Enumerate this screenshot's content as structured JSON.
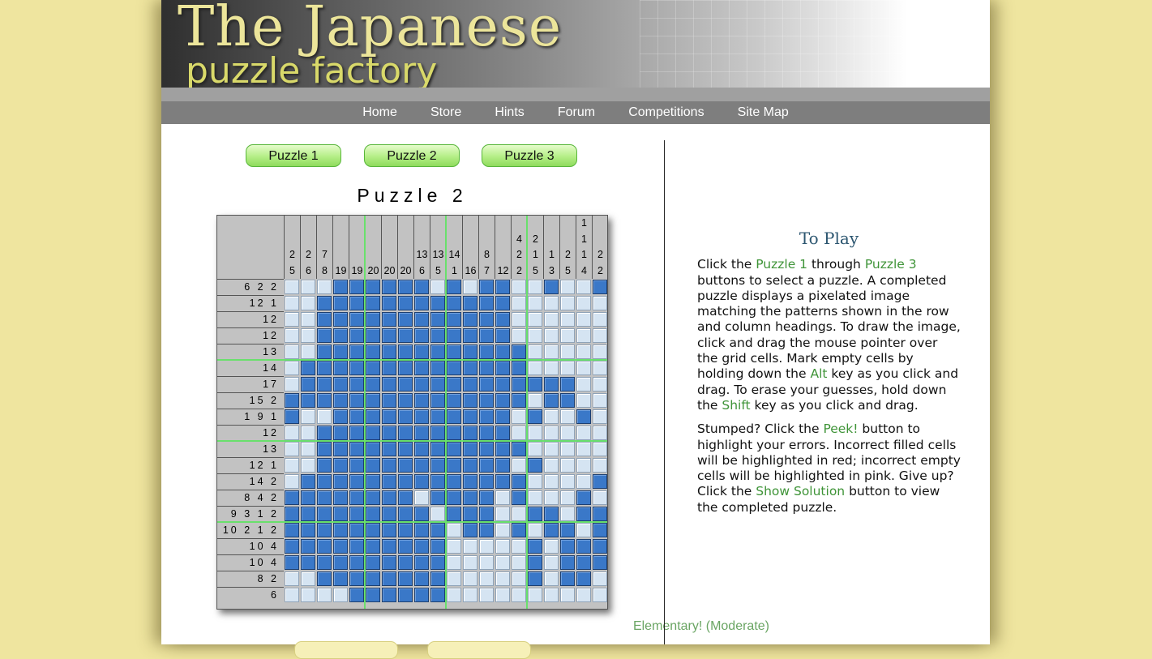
{
  "banner": {
    "title_line1": "The Japanese",
    "title_line2": "puzzle factory"
  },
  "nav": [
    "Home",
    "Store",
    "Hints",
    "Forum",
    "Competitions",
    "Site Map"
  ],
  "puzzle_buttons": [
    "Puzzle 1",
    "Puzzle 2",
    "Puzzle 3"
  ],
  "puzzle_title": "Puzzle 2",
  "column_clues": [
    [
      "2",
      "5"
    ],
    [
      "2",
      "6"
    ],
    [
      "7",
      "8"
    ],
    [
      "19"
    ],
    [
      "19"
    ],
    [
      "20"
    ],
    [
      "20"
    ],
    [
      "20"
    ],
    [
      "13",
      "6"
    ],
    [
      "13",
      "5"
    ],
    [
      "14",
      "1"
    ],
    [
      "16"
    ],
    [
      "8",
      "7"
    ],
    [
      "12"
    ],
    [
      "4",
      "2",
      "2"
    ],
    [
      "2",
      "1",
      "5"
    ],
    [
      "1",
      "3"
    ],
    [
      "2",
      "5"
    ],
    [
      "1",
      "1",
      "1",
      "4"
    ],
    [
      "2",
      "2"
    ]
  ],
  "row_clues": [
    "6 2 2",
    "12 1",
    "12",
    "12",
    "13",
    "14",
    "17",
    "15 2",
    "1 9 1",
    "12",
    "13",
    "12 1",
    "14 2",
    "8 4 2",
    "9 3 1 2",
    "10 2 1 2",
    "10 4",
    "10 4",
    "8 2",
    "6"
  ],
  "grid_rows": [
    "...######.#.##..#..##",
    "..############......#",
    "..############.......",
    "..############.......",
    "..#############......",
    ".##############......",
    ".#################...",
    "###############.##..",
    "#..###########.#..#..",
    "..############.......",
    "..#############......",
    "..############.#....#",
    ".##############....##",
    "########.####.#...#..",
    "#########.###..##.##.",
    "##########.##.#.##.##",
    "##########.....#.####",
    "##########.....#.####",
    "..########.....#.##..",
    "....######..........."
  ],
  "difficulty": "Elementary! (Moderate)",
  "to_play": {
    "heading": "To Play",
    "p1": [
      {
        "t": "Click the ",
        "h": false
      },
      {
        "t": "Puzzle 1",
        "h": true
      },
      {
        "t": " through ",
        "h": false
      },
      {
        "t": "Puzzle 3",
        "h": true
      },
      {
        "t": " buttons to select a puzzle. A completed puzzle displays a pixelated image matching the patterns shown in the row and column headings. To draw the image, click and drag the mouse pointer over the grid cells. Mark empty cells by holding down the ",
        "h": false
      },
      {
        "t": "Alt",
        "h": true
      },
      {
        "t": " key as you click and drag. To erase your guesses, hold down the ",
        "h": false
      },
      {
        "t": "Shift",
        "h": true
      },
      {
        "t": " key as you click and drag.",
        "h": false
      }
    ],
    "p2": [
      {
        "t": "Stumped? Click the ",
        "h": false
      },
      {
        "t": "Peek!",
        "h": true
      },
      {
        "t": " button to highlight your errors. Incorrect filled cells will be highlighted in red; incorrect empty cells will be highlighted in pink. Give up? Click the ",
        "h": false
      },
      {
        "t": "Show Solution",
        "h": true
      },
      {
        "t": " button to view the completed puzzle.",
        "h": false
      }
    ]
  }
}
